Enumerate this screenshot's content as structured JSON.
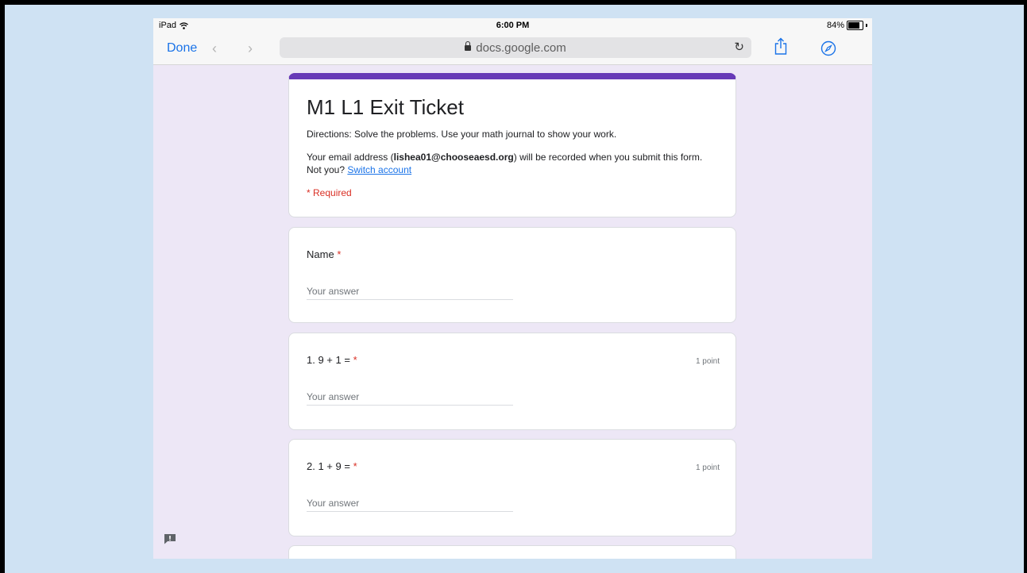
{
  "status_bar": {
    "device": "iPad",
    "time": "6:00 PM",
    "battery": "84%",
    "battery_level": 0.84
  },
  "browser": {
    "done_label": "Done",
    "back_label": "‹",
    "forward_label": "›",
    "url": "docs.google.com",
    "reload_label": "↻"
  },
  "form": {
    "title": "M1 L1 Exit Ticket",
    "directions": "Directions:  Solve the problems.  Use your math journal to show your work.",
    "email_prefix": "Your email address (",
    "email": "lishea01@chooseaesd.org",
    "email_suffix": ") will be recorded when you submit this form. Not you? ",
    "switch_account": "Switch account",
    "required_note": "* Required",
    "accent_color": "#673ab7",
    "questions": [
      {
        "title": "Name",
        "required": "*",
        "points": "",
        "placeholder": "Your answer"
      },
      {
        "title": "1. 9 + 1 =",
        "required": "*",
        "points": "1 point",
        "placeholder": "Your answer"
      },
      {
        "title": "2. 1 + 9 =",
        "required": "*",
        "points": "1 point",
        "placeholder": "Your answer"
      }
    ]
  },
  "icons": [
    "wifi-icon",
    "lock-icon",
    "reload-icon",
    "share-icon",
    "compass-icon",
    "report-issue-icon"
  ]
}
